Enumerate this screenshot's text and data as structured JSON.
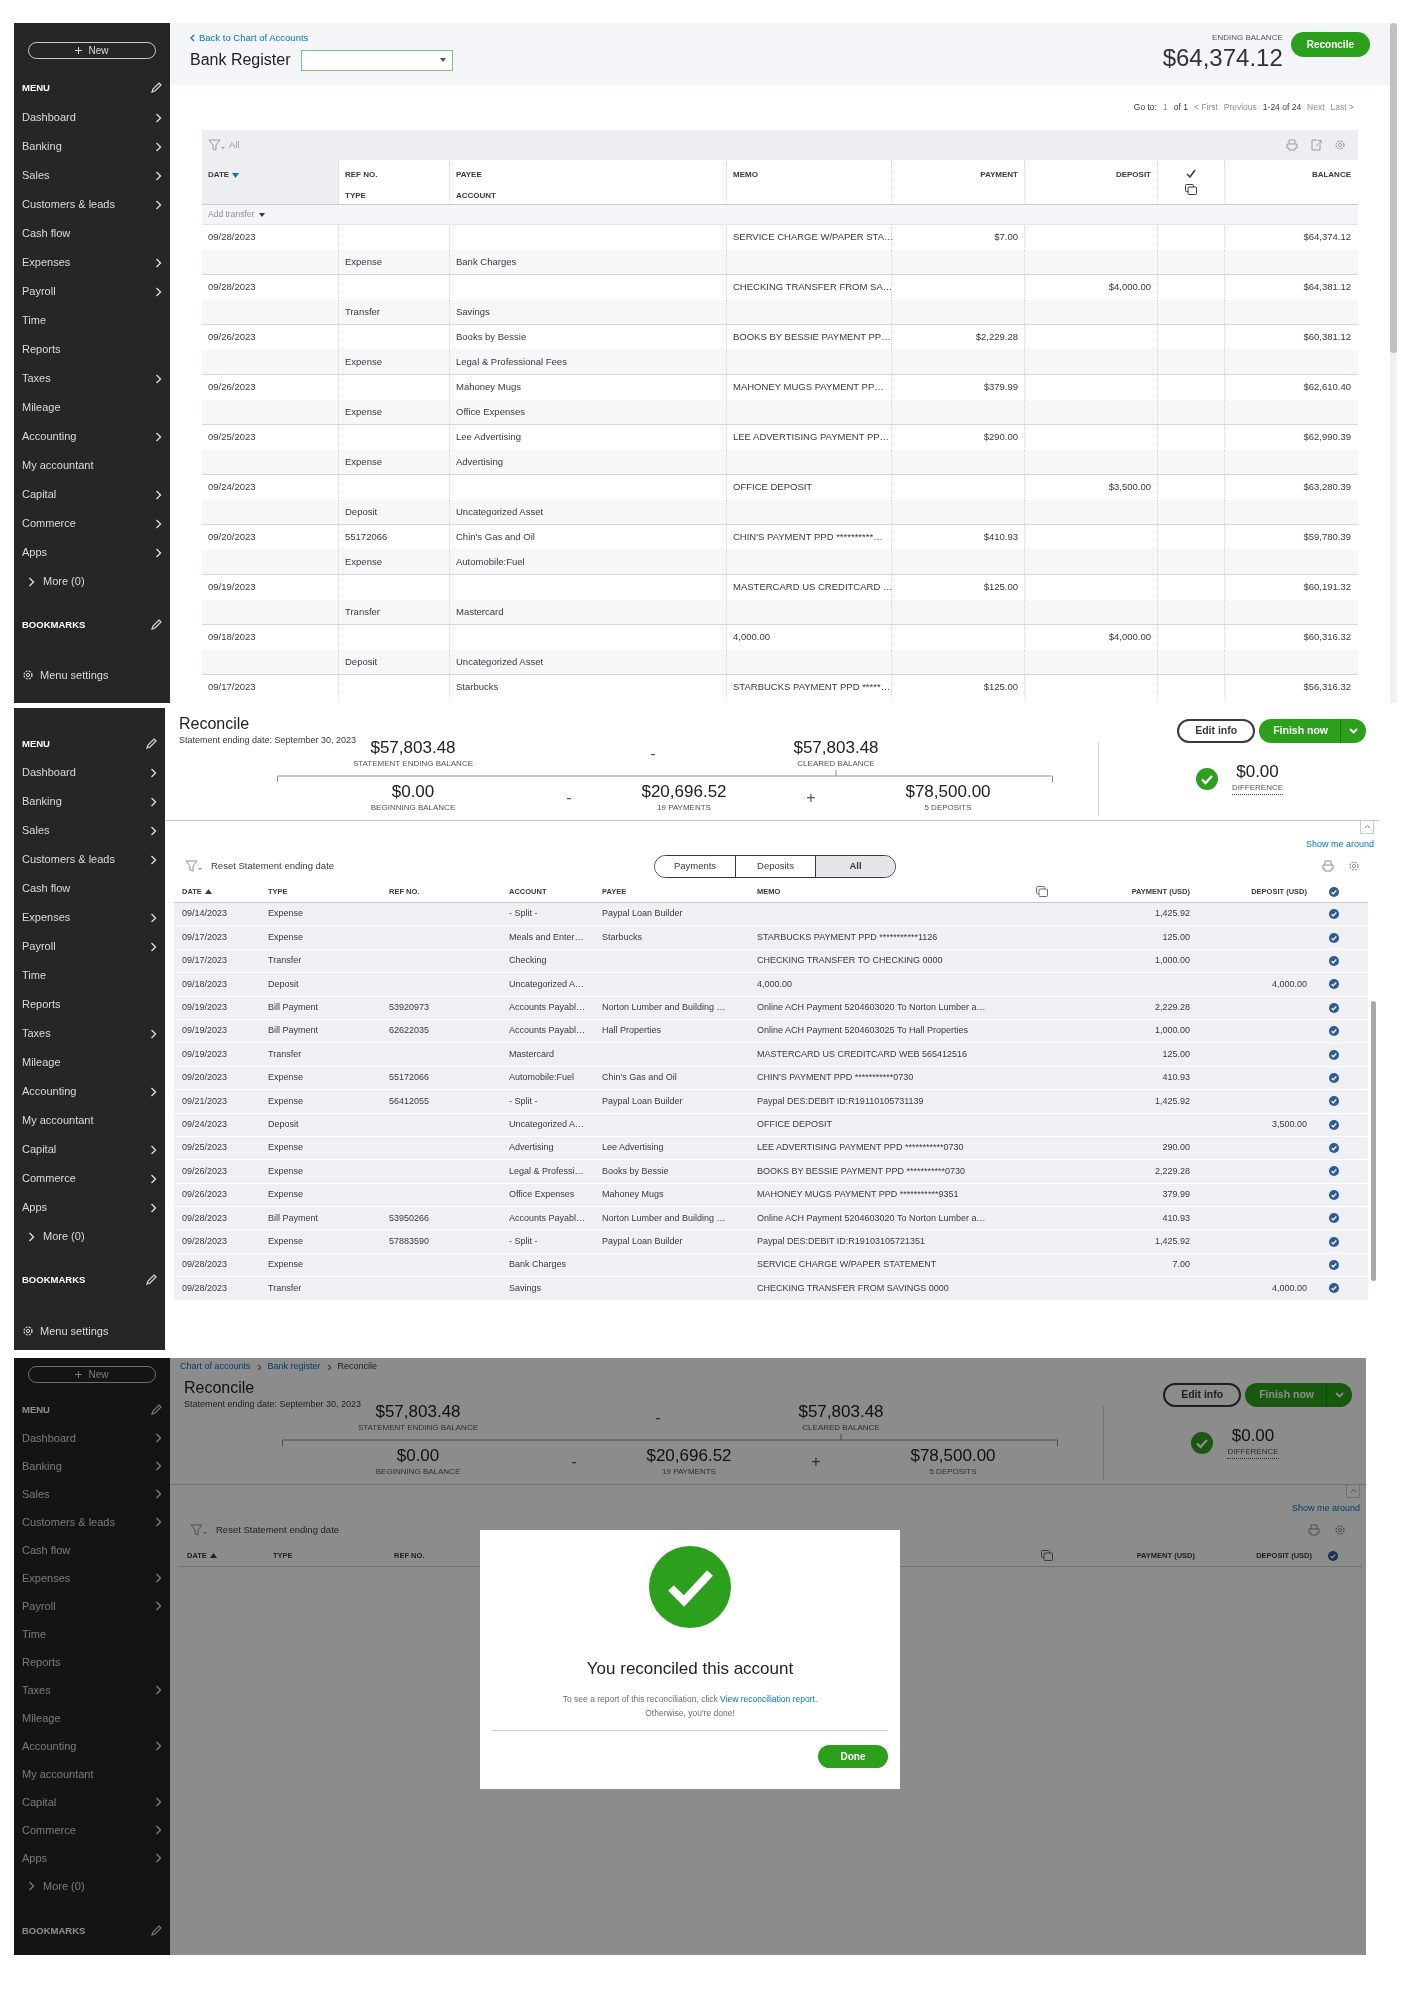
{
  "register_view": {
    "sidebar": {
      "new_button": "New",
      "menu_heading": "MENU",
      "items": [
        {
          "label": "Dashboard",
          "expandable": true
        },
        {
          "label": "Banking",
          "expandable": true
        },
        {
          "label": "Sales",
          "expandable": true
        },
        {
          "label": "Customers & leads",
          "expandable": true
        },
        {
          "label": "Cash flow",
          "expandable": false
        },
        {
          "label": "Expenses",
          "expandable": true
        },
        {
          "label": "Payroll",
          "expandable": true
        },
        {
          "label": "Time",
          "expandable": false
        },
        {
          "label": "Reports",
          "expandable": false
        },
        {
          "label": "Taxes",
          "expandable": true
        },
        {
          "label": "Mileage",
          "expandable": false
        },
        {
          "label": "Accounting",
          "expandable": true
        },
        {
          "label": "My accountant",
          "expandable": false
        },
        {
          "label": "Capital",
          "expandable": true
        },
        {
          "label": "Commerce",
          "expandable": true
        },
        {
          "label": "Apps",
          "expandable": true
        }
      ],
      "more": "More (0)",
      "bookmarks_heading": "BOOKMARKS",
      "menu_settings": "Menu settings"
    },
    "back_link": "Back to Chart of Accounts",
    "title": "Bank Register",
    "ending_balance_label": "ENDING BALANCE",
    "ending_balance": "$64,374.12",
    "reconcile_button": "Reconcile",
    "pager": {
      "goto_label": "Go to:",
      "page": "1",
      "of": "of 1",
      "first": "< First",
      "previous": "Previous",
      "range": "1-24 of 24",
      "next": "Next",
      "last": "Last >"
    },
    "filter_label": "All",
    "columns": [
      {
        "kind": "date",
        "label": "DATE",
        "sort_ascending": false
      },
      {
        "kind": "ref_type",
        "label": "REF NO.",
        "sublabel": "TYPE"
      },
      {
        "kind": "payee_account",
        "label": "PAYEE",
        "sublabel": "ACCOUNT"
      },
      {
        "kind": "memo",
        "label": "MEMO"
      },
      {
        "kind": "payment",
        "label": "PAYMENT"
      },
      {
        "kind": "deposit",
        "label": "DEPOSIT"
      },
      {
        "kind": "check"
      },
      {
        "kind": "balance",
        "label": "BALANCE"
      }
    ],
    "add_transfer": "Add transfer",
    "rows": [
      {
        "date": "09/28/2023",
        "memo": "SERVICE CHARGE W/PAPER STA…",
        "payment": "$7.00",
        "balance": "$64,374.12",
        "type": "Expense",
        "account": "Bank Charges"
      },
      {
        "date": "09/28/2023",
        "memo": "CHECKING TRANSFER FROM SA…",
        "deposit": "$4,000.00",
        "balance": "$64,381.12",
        "type": "Transfer",
        "account": "Savings"
      },
      {
        "date": "09/26/2023",
        "payee": "Books by Bessie",
        "memo": "BOOKS BY BESSIE PAYMENT PP…",
        "payment": "$2,229.28",
        "balance": "$60,381.12",
        "type": "Expense",
        "account": "Legal & Professional Fees"
      },
      {
        "date": "09/26/2023",
        "payee": "Mahoney Mugs",
        "memo": "MAHONEY MUGS PAYMENT PP…",
        "payment": "$379.99",
        "balance": "$62,610.40",
        "type": "Expense",
        "account": "Office Expenses"
      },
      {
        "date": "09/25/2023",
        "payee": "Lee Advertising",
        "memo": "LEE ADVERTISING PAYMENT PP…",
        "payment": "$290.00",
        "balance": "$62,990.39",
        "type": "Expense",
        "account": "Advertising"
      },
      {
        "date": "09/24/2023",
        "memo": "OFFICE DEPOSIT",
        "deposit": "$3,500.00",
        "balance": "$63,280.39",
        "type": "Deposit",
        "account": "Uncategorized Asset"
      },
      {
        "date": "09/20/2023",
        "ref_no": "55172066",
        "payee": "Chin's Gas and Oil",
        "memo": "CHIN'S PAYMENT PPD **********…",
        "payment": "$410.93",
        "balance": "$59,780.39",
        "type": "Expense",
        "account": "Automobile:Fuel"
      },
      {
        "date": "09/19/2023",
        "memo": "MASTERCARD US CREDITCARD …",
        "payment": "$125.00",
        "balance": "$60,191.32",
        "type": "Transfer",
        "account": "Mastercard"
      },
      {
        "date": "09/18/2023",
        "memo": "4,000.00",
        "deposit": "$4,000.00",
        "balance": "$60,316.32",
        "type": "Deposit",
        "account": "Uncategorized Asset"
      },
      {
        "date": "09/17/2023",
        "payee": "Starbucks",
        "memo": "STARBUCKS PAYMENT PPD *****…",
        "payment": "$125.00",
        "balance": "$56,316.32"
      }
    ]
  },
  "reconcile_view": {
    "sidebar": {
      "menu_heading": "MENU",
      "items": [
        {
          "label": "Dashboard",
          "expandable": true
        },
        {
          "label": "Banking",
          "expandable": true
        },
        {
          "label": "Sales",
          "expandable": true
        },
        {
          "label": "Customers & leads",
          "expandable": true
        },
        {
          "label": "Cash flow",
          "expandable": false
        },
        {
          "label": "Expenses",
          "expandable": true
        },
        {
          "label": "Payroll",
          "expandable": true
        },
        {
          "label": "Time",
          "expandable": false
        },
        {
          "label": "Reports",
          "expandable": false
        },
        {
          "label": "Taxes",
          "expandable": true
        },
        {
          "label": "Mileage",
          "expandable": false
        },
        {
          "label": "Accounting",
          "expandable": true
        },
        {
          "label": "My accountant",
          "expandable": false
        },
        {
          "label": "Capital",
          "expandable": true
        },
        {
          "label": "Commerce",
          "expandable": true
        },
        {
          "label": "Apps",
          "expandable": true
        }
      ],
      "more": "More (0)",
      "bookmarks_heading": "BOOKMARKS",
      "menu_settings": "Menu settings"
    },
    "title": "Reconcile",
    "statement_date": "Statement ending date: September 30, 2023",
    "edit_button": "Edit info",
    "finish_button": "Finish now",
    "summary": {
      "statement_ending_balance": {
        "amount": "$57,803.48",
        "label": "STATEMENT ENDING BALANCE"
      },
      "minus_top": "-",
      "cleared_balance": {
        "amount": "$57,803.48",
        "label": "CLEARED BALANCE"
      },
      "beginning_balance": {
        "amount": "$0.00",
        "label": "BEGINNING BALANCE"
      },
      "minus_bottom": "-",
      "payments": {
        "amount": "$20,696.52",
        "label": "19 PAYMENTS"
      },
      "plus": "+",
      "deposits": {
        "amount": "$78,500.00",
        "label": "5 DEPOSITS"
      },
      "difference": {
        "amount": "$0.00",
        "label": "DIFFERENCE"
      }
    },
    "show_me_around": "Show me around",
    "reset_link": "Reset Statement ending date",
    "tabs": [
      {
        "label": "Payments",
        "selected": false
      },
      {
        "label": "Deposits",
        "selected": false
      },
      {
        "label": "All",
        "selected": true
      }
    ],
    "columns": [
      {
        "kind": "date",
        "label": "DATE",
        "sort_ascending": true
      },
      {
        "kind": "type",
        "label": "TYPE"
      },
      {
        "kind": "ref_no",
        "label": "REF NO."
      },
      {
        "kind": "account",
        "label": "ACCOUNT"
      },
      {
        "kind": "payee",
        "label": "PAYEE"
      },
      {
        "kind": "memo",
        "label": "MEMO"
      },
      {
        "kind": "copy"
      },
      {
        "kind": "payment",
        "label": "PAYMENT (USD)"
      },
      {
        "kind": "deposit",
        "label": "DEPOSIT (USD)"
      },
      {
        "kind": "check"
      }
    ],
    "rows": [
      {
        "date": "09/14/2023",
        "type": "Expense",
        "account": "- Split -",
        "payee": "Paypal Loan Builder",
        "payment": "1,425.92",
        "cleared": true
      },
      {
        "date": "09/17/2023",
        "type": "Expense",
        "account": "Meals and Enter…",
        "payee": "Starbucks",
        "memo": "STARBUCKS PAYMENT PPD ***********1126",
        "payment": "125.00",
        "cleared": true
      },
      {
        "date": "09/17/2023",
        "type": "Transfer",
        "account": "Checking",
        "memo": "CHECKING TRANSFER TO CHECKING 0000",
        "payment": "1,000.00",
        "cleared": true
      },
      {
        "date": "09/18/2023",
        "type": "Deposit",
        "account": "Uncategorized A…",
        "memo": "4,000.00",
        "deposit": "4,000.00",
        "cleared": true
      },
      {
        "date": "09/19/2023",
        "type": "Bill Payment",
        "ref_no": "53920973",
        "account": "Accounts Payabl…",
        "payee": "Norton Lumber and Building …",
        "memo": "Online ACH Payment 5204603020 To Norton Lumber a…",
        "payment": "2,229.28",
        "cleared": true
      },
      {
        "date": "09/19/2023",
        "type": "Bill Payment",
        "ref_no": "62622035",
        "account": "Accounts Payabl…",
        "payee": "Hall Properties",
        "memo": "Online ACH Payment 5204603025 To Hall Properties",
        "payment": "1,000.00",
        "cleared": true
      },
      {
        "date": "09/19/2023",
        "type": "Transfer",
        "account": "Mastercard",
        "memo": "MASTERCARD US CREDITCARD WEB 565412516",
        "payment": "125.00",
        "cleared": true
      },
      {
        "date": "09/20/2023",
        "type": "Expense",
        "ref_no": "55172066",
        "account": "Automobile:Fuel",
        "payee": "Chin's Gas and Oil",
        "memo": "CHIN'S PAYMENT PPD ***********0730",
        "payment": "410.93",
        "cleared": true
      },
      {
        "date": "09/21/2023",
        "type": "Expense",
        "ref_no": "56412055",
        "account": "- Split -",
        "payee": "Paypal Loan Builder",
        "memo": "Paypal DES:DEBIT ID:R19110105731139",
        "payment": "1,425.92",
        "cleared": true
      },
      {
        "date": "09/24/2023",
        "type": "Deposit",
        "account": "Uncategorized A…",
        "memo": "OFFICE DEPOSIT",
        "deposit": "3,500.00",
        "cleared": true
      },
      {
        "date": "09/25/2023",
        "type": "Expense",
        "account": "Advertising",
        "payee": "Lee Advertising",
        "memo": "LEE ADVERTISING PAYMENT PPD ***********0730",
        "payment": "290.00",
        "cleared": true
      },
      {
        "date": "09/26/2023",
        "type": "Expense",
        "account": "Legal & Professi…",
        "payee": "Books by Bessie",
        "memo": "BOOKS BY BESSIE PAYMENT PPD ***********0730",
        "payment": "2,229.28",
        "cleared": true
      },
      {
        "date": "09/26/2023",
        "type": "Expense",
        "account": "Office Expenses",
        "payee": "Mahoney Mugs",
        "memo": "MAHONEY MUGS PAYMENT PPD ***********9351",
        "payment": "379.99",
        "cleared": true
      },
      {
        "date": "09/28/2023",
        "type": "Bill Payment",
        "ref_no": "53950266",
        "account": "Accounts Payabl…",
        "payee": "Norton Lumber and Building …",
        "memo": "Online ACH Payment 5204603020 To Norton Lumber a…",
        "payment": "410.93",
        "cleared": true
      },
      {
        "date": "09/28/2023",
        "type": "Expense",
        "ref_no": "57883590",
        "account": "- Split -",
        "payee": "Paypal Loan Builder",
        "memo": "Paypal DES:DEBIT ID:R19103105721351",
        "payment": "1,425.92",
        "cleared": true
      },
      {
        "date": "09/28/2023",
        "type": "Expense",
        "account": "Bank Charges",
        "memo": "SERVICE CHARGE W/PAPER STATEMENT",
        "payment": "7.00",
        "cleared": true
      },
      {
        "date": "09/28/2023",
        "type": "Transfer",
        "account": "Savings",
        "memo": "CHECKING TRANSFER FROM SAVINGS 0000",
        "deposit": "4,000.00",
        "cleared": true
      }
    ]
  },
  "reconciled_view": {
    "sidebar": {
      "new_button": "New",
      "menu_heading": "MENU",
      "items": [
        {
          "label": "Dashboard",
          "expandable": true
        },
        {
          "label": "Banking",
          "expandable": true
        },
        {
          "label": "Sales",
          "expandable": true
        },
        {
          "label": "Customers & leads",
          "expandable": true
        },
        {
          "label": "Cash flow",
          "expandable": false
        },
        {
          "label": "Expenses",
          "expandable": true
        },
        {
          "label": "Payroll",
          "expandable": true
        },
        {
          "label": "Time",
          "expandable": false
        },
        {
          "label": "Reports",
          "expandable": false
        },
        {
          "label": "Taxes",
          "expandable": true
        },
        {
          "label": "Mileage",
          "expandable": false
        },
        {
          "label": "Accounting",
          "expandable": true
        },
        {
          "label": "My accountant",
          "expandable": false
        },
        {
          "label": "Capital",
          "expandable": true
        },
        {
          "label": "Commerce",
          "expandable": true
        },
        {
          "label": "Apps",
          "expandable": true
        }
      ],
      "more": "More (0)",
      "bookmarks_heading": "BOOKMARKS"
    },
    "breadcrumb": [
      "Chart of accounts",
      "Bank register",
      "Reconcile"
    ],
    "title": "Reconcile",
    "statement_date": "Statement ending date: September 30, 2023",
    "edit_button": "Edit info",
    "finish_button": "Finish now",
    "summary": {
      "statement_ending_balance": {
        "amount": "$57,803.48",
        "label": "STATEMENT ENDING BALANCE"
      },
      "minus_top": "-",
      "cleared_balance": {
        "amount": "$57,803.48",
        "label": "CLEARED BALANCE"
      },
      "beginning_balance": {
        "amount": "$0.00",
        "label": "BEGINNING BALANCE"
      },
      "minus_bottom": "-",
      "payments": {
        "amount": "$20,696.52",
        "label": "19 PAYMENTS"
      },
      "plus": "+",
      "deposits": {
        "amount": "$78,500.00",
        "label": "5 DEPOSITS"
      },
      "difference": {
        "amount": "$0.00",
        "label": "DIFFERENCE"
      }
    },
    "show_me_around": "Show me around",
    "reset_link": "Reset Statement ending date",
    "columns": [
      {
        "kind": "date",
        "label": "DATE",
        "sort_ascending": true
      },
      {
        "kind": "type",
        "label": "TYPE"
      },
      {
        "kind": "ref_no",
        "label": "REF NO."
      },
      {
        "kind": "copy"
      },
      {
        "kind": "payment",
        "label": "PAYMENT (USD)"
      },
      {
        "kind": "deposit",
        "label": "DEPOSIT (USD)"
      },
      {
        "kind": "check"
      }
    ],
    "dialog": {
      "title": "You reconciled this account",
      "message": "To see a report of this reconciliation, click ",
      "link": "View reconciliation report",
      "message_end": ".",
      "message_line2": "Otherwise, you're done!",
      "done_button": "Done"
    }
  }
}
